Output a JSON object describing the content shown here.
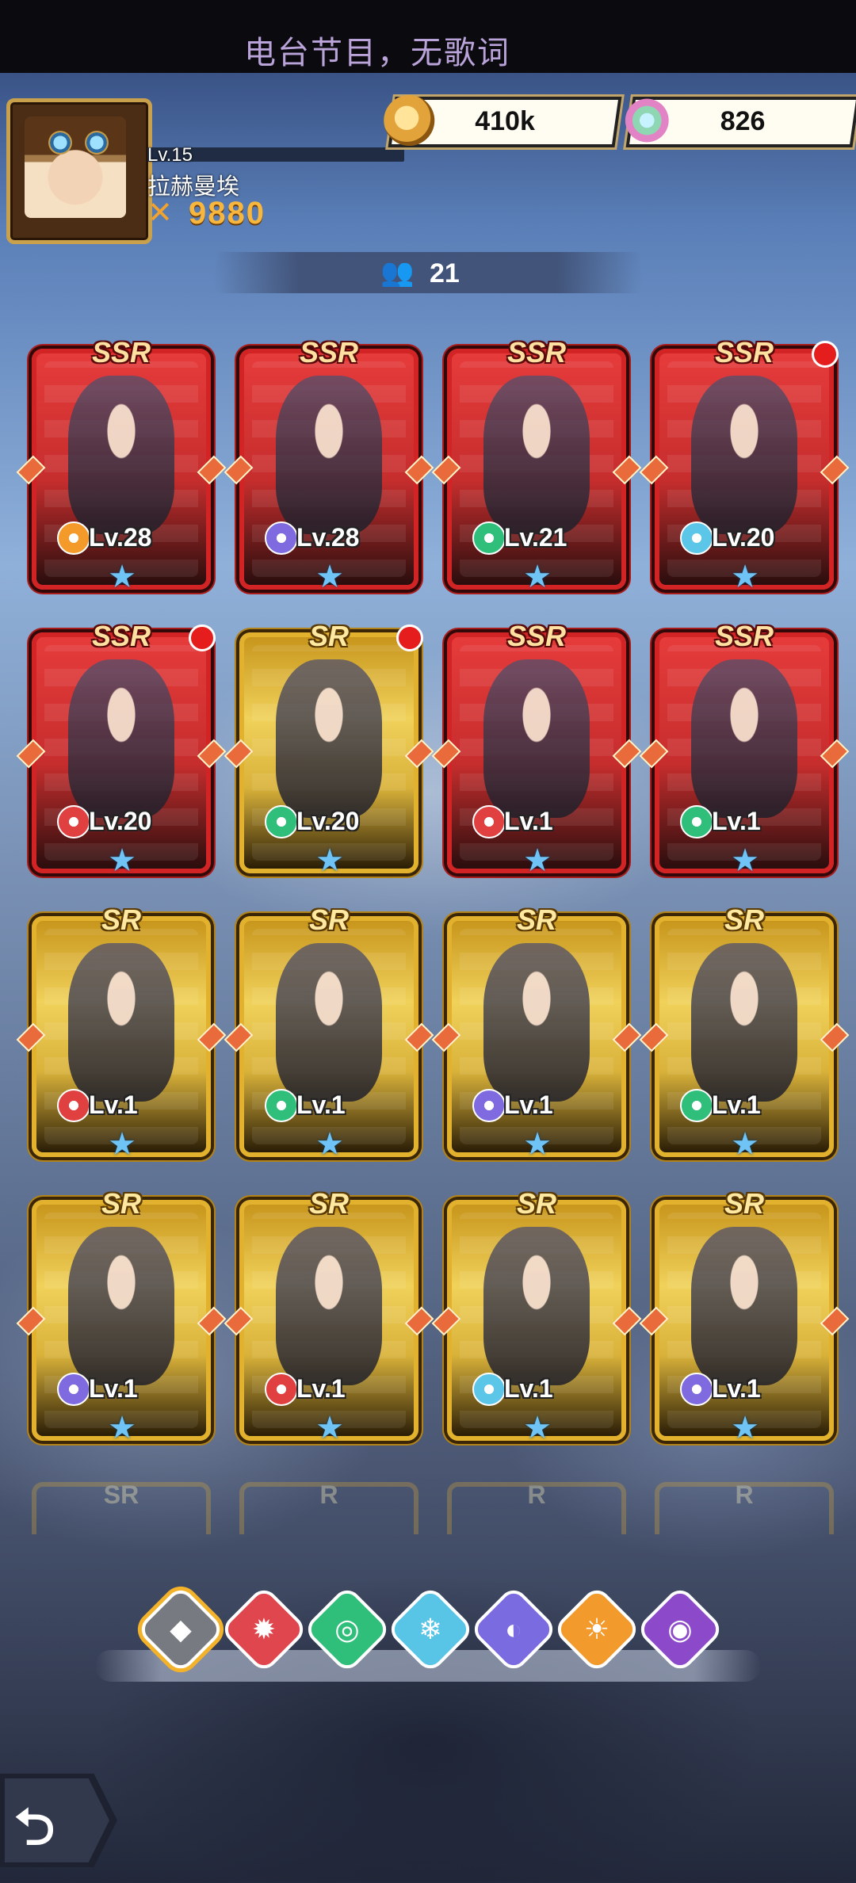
{
  "status": {
    "text": "电台节目，无歌词"
  },
  "player": {
    "level": "Lv.15",
    "name": "拉赫曼埃",
    "power": "9880",
    "level_progress": 0.0
  },
  "resources": {
    "gold": "410k",
    "crystal": "826"
  },
  "hero_count": "21",
  "heroes": [
    {
      "rarity": "SSR",
      "level": "Lv.28",
      "element": "light",
      "red_dot": false
    },
    {
      "rarity": "SSR",
      "level": "Lv.28",
      "element": "water",
      "red_dot": false
    },
    {
      "rarity": "SSR",
      "level": "Lv.21",
      "element": "wind",
      "red_dot": false
    },
    {
      "rarity": "SSR",
      "level": "Lv.20",
      "element": "ice",
      "red_dot": true
    },
    {
      "rarity": "SSR",
      "level": "Lv.20",
      "element": "fire",
      "red_dot": true
    },
    {
      "rarity": "SR",
      "level": "Lv.20",
      "element": "wind",
      "red_dot": true
    },
    {
      "rarity": "SSR",
      "level": "Lv.1",
      "element": "fire",
      "red_dot": false
    },
    {
      "rarity": "SSR",
      "level": "Lv.1",
      "element": "wind",
      "red_dot": false
    },
    {
      "rarity": "SR",
      "level": "Lv.1",
      "element": "fire",
      "red_dot": false
    },
    {
      "rarity": "SR",
      "level": "Lv.1",
      "element": "wind",
      "red_dot": false
    },
    {
      "rarity": "SR",
      "level": "Lv.1",
      "element": "water",
      "red_dot": false
    },
    {
      "rarity": "SR",
      "level": "Lv.1",
      "element": "wind",
      "red_dot": false
    },
    {
      "rarity": "SR",
      "level": "Lv.1",
      "element": "water",
      "red_dot": false
    },
    {
      "rarity": "SR",
      "level": "Lv.1",
      "element": "fire",
      "red_dot": false
    },
    {
      "rarity": "SR",
      "level": "Lv.1",
      "element": "ice",
      "red_dot": false
    },
    {
      "rarity": "SR",
      "level": "Lv.1",
      "element": "water",
      "red_dot": false
    }
  ],
  "partial_row": [
    "SR",
    "R",
    "R",
    "R"
  ],
  "filters": [
    {
      "name": "all",
      "selected": true
    },
    {
      "name": "fire",
      "selected": false
    },
    {
      "name": "wind",
      "selected": false
    },
    {
      "name": "ice",
      "selected": false
    },
    {
      "name": "water",
      "selected": false
    },
    {
      "name": "light",
      "selected": false
    },
    {
      "name": "dark",
      "selected": false
    }
  ],
  "icons": {
    "gold": "coin-icon",
    "crystal": "feather-icon",
    "count": "people-icon",
    "power": "swords-icon",
    "back": "back-arrow-icon",
    "star": "star-icon"
  }
}
